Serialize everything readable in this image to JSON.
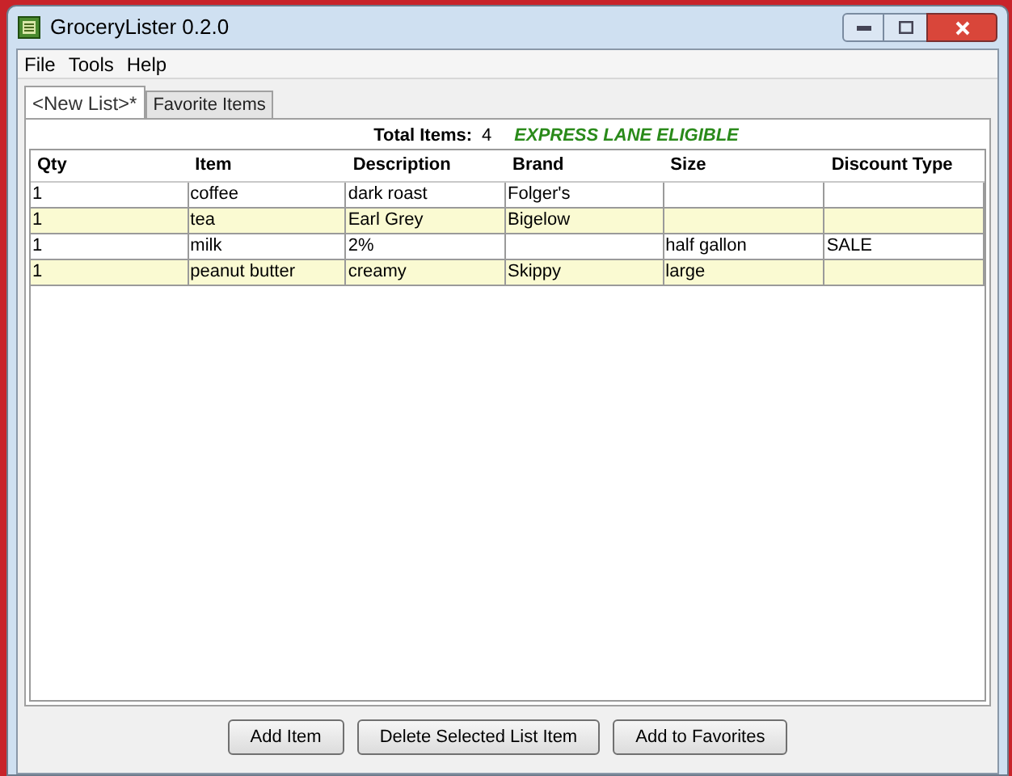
{
  "window": {
    "title": "GroceryLister 0.2.0"
  },
  "menu": [
    "File",
    "Tools",
    "Help"
  ],
  "tabs": [
    {
      "label": "<New List>*",
      "selected": true
    },
    {
      "label": "Favorite Items",
      "selected": false
    }
  ],
  "summary": {
    "label": "Total Items:",
    "count": "4",
    "badge": "EXPRESS LANE ELIGIBLE"
  },
  "table": {
    "columns": [
      "Qty",
      "Item",
      "Description",
      "Brand",
      "Size",
      "Discount Type"
    ],
    "rows": [
      [
        "1",
        "coffee",
        "dark roast",
        "Folger's",
        "",
        ""
      ],
      [
        "1",
        "tea",
        "Earl Grey",
        "Bigelow",
        "",
        ""
      ],
      [
        "1",
        "milk",
        "2%",
        "",
        "half gallon",
        "SALE"
      ],
      [
        "1",
        "peanut butter",
        "creamy",
        "Skippy",
        "large",
        ""
      ]
    ]
  },
  "buttons": [
    "Add Item",
    "Delete Selected List Item",
    "Add to Favorites"
  ]
}
